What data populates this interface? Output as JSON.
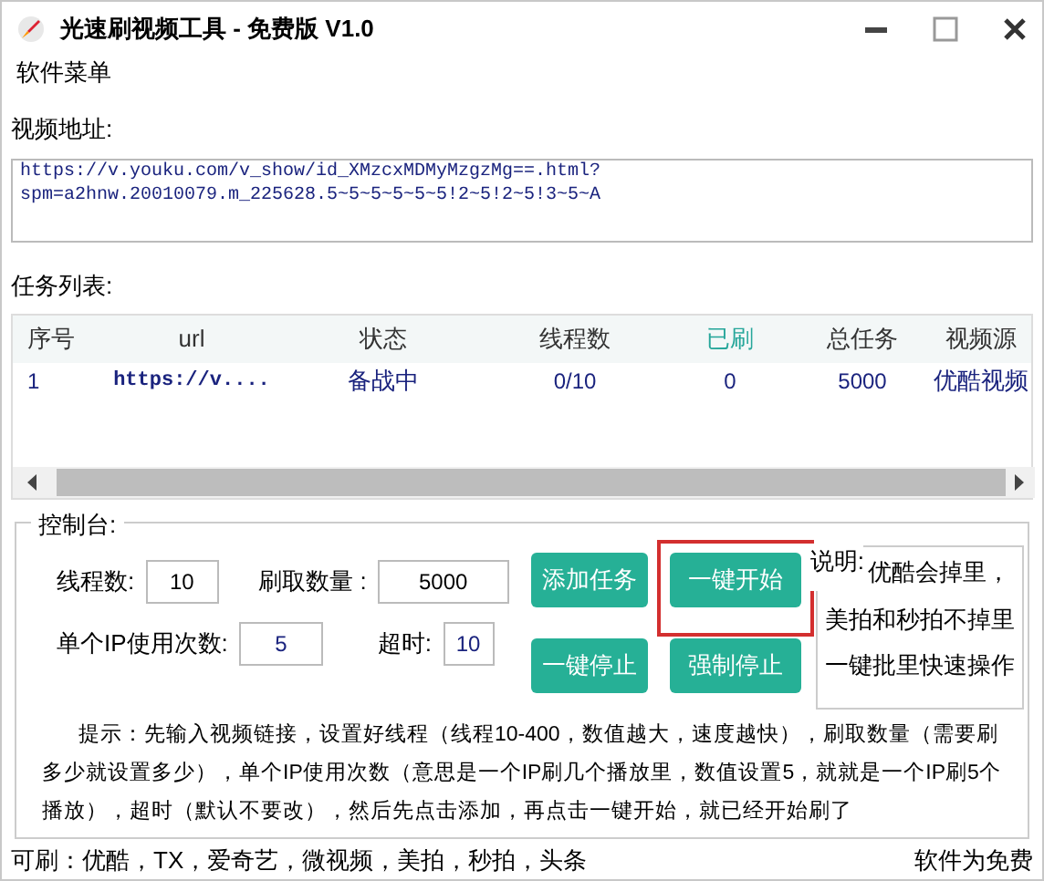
{
  "window": {
    "title": "光速刷视频工具 - 免费版 V1.0"
  },
  "menu": [
    {
      "label": "软件菜单"
    }
  ],
  "video_url": {
    "label": "视频地址:",
    "value": "https://v.youku.com/v_show/id_XMzcxMDMyMzgzMg==.html?\nspm=a2hnw.20010079.m_225628.5~5~5~5~5~5!2~5!2~5!3~5~A"
  },
  "task_list": {
    "label": "任务列表:",
    "columns": [
      {
        "label": "序号",
        "highlighted": false
      },
      {
        "label": "url",
        "highlighted": false
      },
      {
        "label": "状态",
        "highlighted": false
      },
      {
        "label": "线程数",
        "highlighted": false
      },
      {
        "label": "已刷",
        "highlighted": true
      },
      {
        "label": "总任务",
        "highlighted": false
      },
      {
        "label": "视频源",
        "highlighted": false
      }
    ],
    "rows": [
      {
        "cells": [
          "1",
          "https://v....",
          "备战中",
          "0/10",
          "0",
          "5000",
          "优酷视频"
        ]
      }
    ]
  },
  "control": {
    "title": "控制台:",
    "field_rows": [
      [
        {
          "label": "线程数:",
          "value": "10"
        },
        {
          "label": "刷取数量 :",
          "value": "5000"
        }
      ],
      [
        {
          "label": "单个IP使用次数:",
          "value": "5"
        },
        {
          "label": "超时:",
          "value": "10"
        }
      ]
    ],
    "buttons": [
      {
        "label": "添加任务",
        "highlighted": false
      },
      {
        "label": "一键开始",
        "highlighted": true
      },
      {
        "label": "一键停止",
        "highlighted": false
      },
      {
        "label": "强制停止",
        "highlighted": false
      }
    ],
    "note": {
      "label": "说明:",
      "lines": [
        "优酷会掉里，",
        "美拍和秒拍不掉里",
        "一键批里快速操作"
      ]
    },
    "tip": "提示：先输入视频链接，设置好线程（线程10-400，数值越大，速度越快），刷取数量（需要刷多少就设置多少），单个IP使用次数（意思是一个IP刷几个播放里，数值设置5，就就是一个IP刷5个播放），超时（默认不要改），然后先点击添加，再点击一键开始，就已经开始刷了"
  },
  "status_bar": {
    "left": "可刷：优酷，TX，爱奇艺，微视频，美拍，秒拍，头条",
    "right": "软件为免费"
  }
}
